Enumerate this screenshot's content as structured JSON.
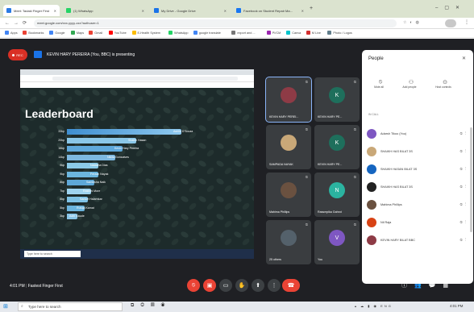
{
  "browser": {
    "tabs": [
      {
        "label": "Meet: Tadaki Finger First",
        "color": "#2b7be4",
        "active": true
      },
      {
        "label": "(1) WhatsApp",
        "color": "#25d366"
      },
      {
        "label": "My Drive - Google Drive",
        "color": "#1a73e8"
      },
      {
        "label": "Facebook on Student Repair Ma...",
        "color": "#1877f2"
      }
    ],
    "url": "meet.google.com/xxx-yyyy-zzz?authuser=1",
    "bookmarks": [
      {
        "label": "Apps",
        "color": "#4285f4"
      },
      {
        "label": "Bookmarks",
        "color": "#ea4335"
      },
      {
        "label": "Google",
        "color": "#4285f4"
      },
      {
        "label": "Maps",
        "color": "#34a853"
      },
      {
        "label": "Gmail",
        "color": "#ea4335"
      },
      {
        "label": "YouTube",
        "color": "#ff0000"
      },
      {
        "label": "E-Health System",
        "color": "#fbbc04"
      },
      {
        "label": "WhatsApp",
        "color": "#25d366"
      },
      {
        "label": "google translate",
        "color": "#4285f4"
      },
      {
        "label": "export and ...",
        "color": "#777777"
      },
      {
        "label": "PI/CM",
        "color": "#9c27b0"
      },
      {
        "label": "Canva",
        "color": "#00c4cc"
      },
      {
        "label": "M Live",
        "color": "#d32f2f"
      },
      {
        "label": "Photo / Logos",
        "color": "#607d8b"
      }
    ]
  },
  "meet": {
    "rec_label": "REC",
    "presenting_label": "KEVIN HARY PEREIRA (You, BBC) is presenting",
    "time": "4:01 PM",
    "meeting_name": "Fastest Finger First",
    "presentation": {
      "heading": "Leaderboard",
      "leaderboard_names": [
        "Ashlin D'Souza",
        "Shaikh Hasan",
        "Kevin Hary Pereira",
        "Nikita Gonsalves",
        "Natasha Dias",
        "Ferzan Nayak",
        "Samiksha Naik",
        "Rashmi More",
        "Sanket Halarnkar",
        "Rutuja Kamat",
        "Aditi Gaude"
      ],
      "leaderboard_scores": [
        "33kp",
        "20kp",
        "16kp",
        "14kp",
        "9kp",
        "9kp",
        "8kp",
        "7kp",
        "6kp",
        "5kp",
        "3kp"
      ],
      "leaderboard_values": [
        33,
        20,
        16,
        14,
        9,
        9,
        8,
        7,
        6,
        5,
        3
      ],
      "taskbar_search": "Type here to search"
    },
    "tiles": [
      {
        "name": "KEVIN HARY PEREI...",
        "color": "#8e3b46",
        "initial": "",
        "is_photo": true
      },
      {
        "name": "KEVIN HARY PE...",
        "color": "#1e6f5c",
        "initial": "K"
      },
      {
        "name": "SAMPADA NAYAK",
        "color": "#c9a878",
        "initial": "",
        "is_photo": true
      },
      {
        "name": "KEVIN HARY PE...",
        "color": "#1e6f5c",
        "initial": "K"
      },
      {
        "name": "Mahima Phillips",
        "color": "#6a5140",
        "initial": "",
        "is_photo": true
      },
      {
        "name": "Rassmpika Gahrot",
        "color": "#2bb3a0",
        "initial": "N"
      },
      {
        "name": "25 others",
        "color": "#54616b",
        "initial": "",
        "is_group": true
      },
      {
        "name": "You",
        "color": "#7e57c2",
        "initial": "V"
      }
    ],
    "controls": [
      "mic",
      "cam",
      "cc",
      "hand",
      "present",
      "more",
      "end"
    ]
  },
  "people": {
    "title": "People",
    "actions": [
      "Mute all",
      "Add people",
      "Host controls"
    ],
    "section_label": "IN CALL",
    "participants": [
      {
        "name": "Adarsh Tikoo (You)",
        "color": "#7e57c2"
      },
      {
        "name": "SHAIKH HAS BILAT 3S",
        "color": "#c9a878"
      },
      {
        "name": "SHAIKH HASAN BILAT 3S",
        "color": "#1565c0"
      },
      {
        "name": "SHAIKH HAS BILAT 3S",
        "color": "#222222"
      },
      {
        "name": "Mahima Phillips",
        "color": "#6a5140"
      },
      {
        "name": "Nil Raja",
        "color": "#d84315"
      },
      {
        "name": "KEVIN HARY BILAT BBC",
        "color": "#8e3b46"
      }
    ]
  },
  "system": {
    "search": "Type here to search",
    "clock": "4:01 PM"
  }
}
